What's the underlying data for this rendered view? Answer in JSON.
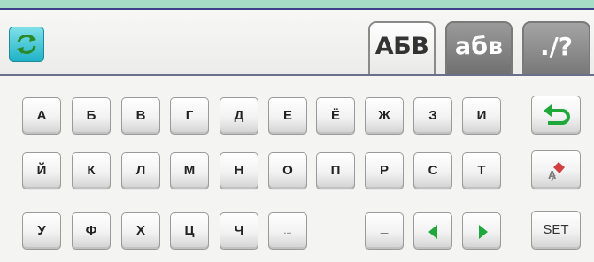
{
  "header": {
    "tabs": [
      {
        "label": "АБВ",
        "active": true
      },
      {
        "label": "абв",
        "active": false
      },
      {
        "label": "./?",
        "active": false
      }
    ],
    "swap_icon": "swap-arrows-icon"
  },
  "keyboard": {
    "row1": [
      "А",
      "Б",
      "В",
      "Г",
      "Д",
      "Е",
      "Ё",
      "Ж",
      "З",
      "И"
    ],
    "row2": [
      "Й",
      "К",
      "Л",
      "М",
      "Н",
      "О",
      "П",
      "Р",
      "С",
      "Т"
    ],
    "row3": [
      "У",
      "Ф",
      "Х",
      "Ц",
      "Ч",
      "..."
    ],
    "space_label": "_",
    "set_label": "SET",
    "icons": {
      "return": "return-arrow-icon",
      "delete": "delete-char-icon",
      "left": "arrow-left-icon",
      "right": "arrow-right-icon"
    }
  },
  "colors": {
    "top_accent": "#a6ddc6",
    "arrow_green": "#1fa83a",
    "swap_cyan": "#1fb2c8"
  }
}
